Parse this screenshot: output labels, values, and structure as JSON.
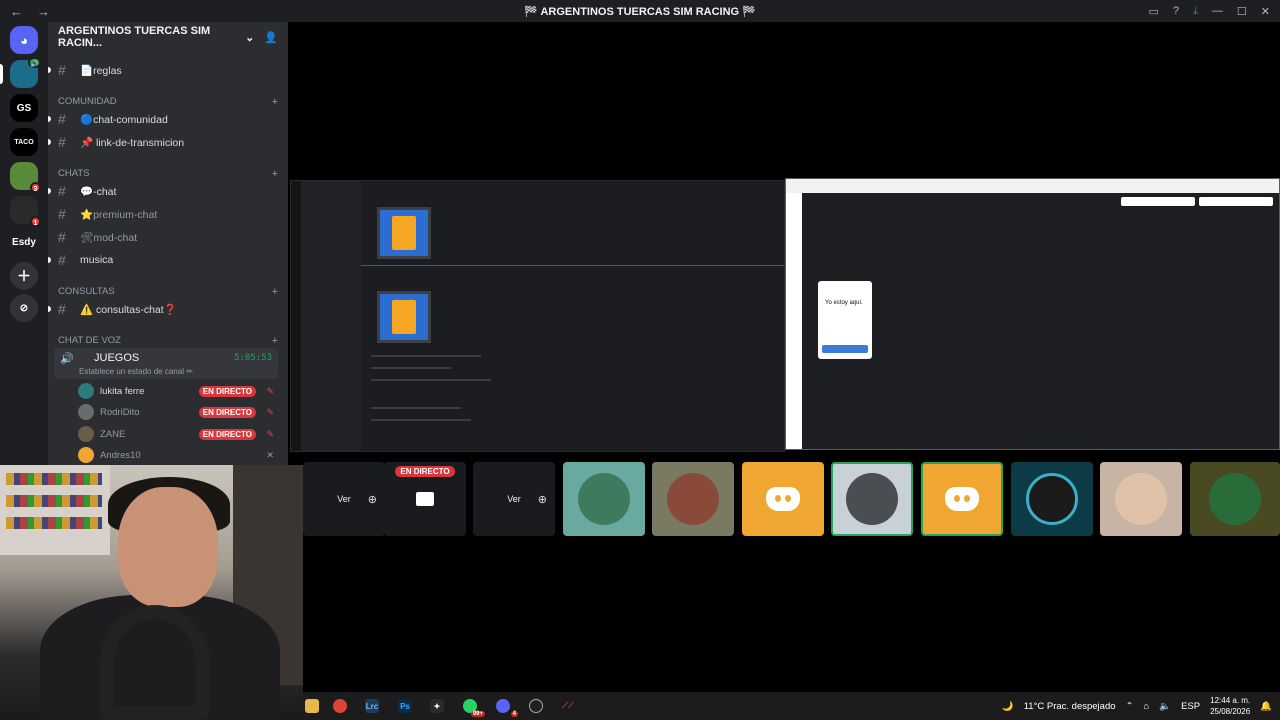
{
  "window": {
    "title": "ARGENTINOS TUERCAS SIM RACING"
  },
  "server": {
    "name": "ARGENTINOS TUERCAS SIM RACIN..."
  },
  "guilds": [
    {
      "label": "",
      "color": "#1c6d8a",
      "badge": ""
    },
    {
      "label": "GS",
      "color": "#000000",
      "badge": ""
    },
    {
      "label": "TACO",
      "color": "#000000",
      "badge": ""
    },
    {
      "label": "",
      "color": "#5a8a3a",
      "badge": "3"
    },
    {
      "label": "",
      "color": "#2a2a2a",
      "badge": "1"
    },
    {
      "label": "Esdy",
      "color": "#1e1f22",
      "badge": ""
    }
  ],
  "categories": {
    "comunidad": "COMUNIDAD",
    "chats": "CHATS",
    "consultas": "CONSULTAS",
    "voz": "CHAT DE VOZ"
  },
  "channels": {
    "reglas": "📄reglas",
    "chat_comunidad": "🔵chat-comunidad",
    "link": "📌 link-de-transmicion",
    "chat": "💬-chat",
    "premium": "⭐premium-chat",
    "mod": "🛠mod-chat",
    "musica": "musica",
    "consultas": "⚠️ consultas-chat❓"
  },
  "voice": {
    "channel": "JUEGOS",
    "timer": "5:05:53",
    "status": "Establece un estado de canal ✏",
    "users": [
      {
        "name": "lukita ferre",
        "live": "EN DIRECTO",
        "color": "#2c7a7b"
      },
      {
        "name": "RodriDito",
        "live": "EN DIRECTO",
        "color": "#6b6b6b"
      },
      {
        "name": "ZANE",
        "live": "EN DIRECTO",
        "color": "#6b5c4a"
      },
      {
        "name": "Andres10",
        "live": "",
        "color": "#f0a732"
      }
    ]
  },
  "stream_preview": {
    "popup_text": "Yo estoy aquí.",
    "live_label": "EN DIRECTO"
  },
  "tiles": {
    "ver": "Ver",
    "live": "EN DIRECTO"
  },
  "taskbar": {
    "weather": "11°C  Prac. despejado",
    "lang": "ESP",
    "time": "12:44 a. m.",
    "date": "25/08/2026",
    "whatsapp_badge": "99+",
    "discord_badge": "4"
  },
  "colors": {
    "accent": "#23a55a",
    "live": "#da373c",
    "discord_yellow": "#f0a732"
  }
}
